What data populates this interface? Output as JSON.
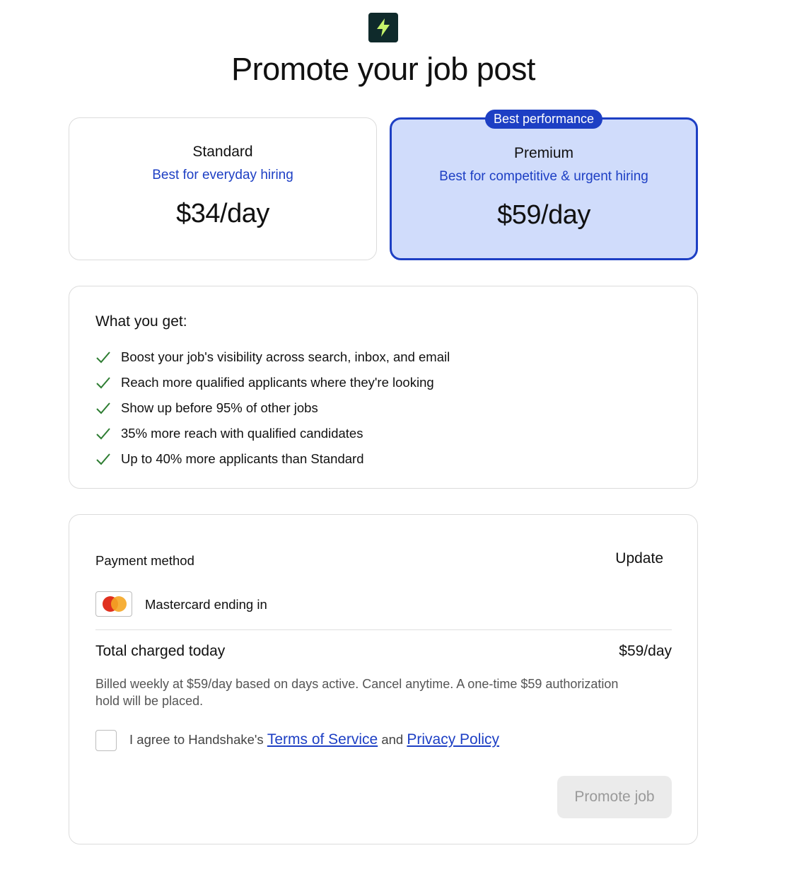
{
  "header": {
    "logo_icon": "lightning-bolt-icon",
    "title": "Promote your job post"
  },
  "plans": [
    {
      "name": "Standard",
      "tagline": "Best for everyday hiring",
      "price": "$34/day",
      "selected": false
    },
    {
      "name": "Premium",
      "tagline": "Best for competitive & urgent hiring",
      "price": "$59/day",
      "selected": true,
      "badge": "Best performance"
    }
  ],
  "benefits": {
    "heading": "What you get:",
    "items": [
      "Boost your job's visibility across search, inbox, and email",
      "Reach more qualified applicants where they're looking",
      "Show up before 95% of other jobs",
      "35% more reach with qualified candidates",
      "Up to 40% more applicants than Standard"
    ]
  },
  "payment": {
    "label": "Payment method",
    "update_label": "Update",
    "card_icon": "mastercard-icon",
    "card_text": "Mastercard ending in",
    "total_label": "Total charged today",
    "total_value": "$59/day",
    "billing_note": "Billed weekly at $59/day based on days active. Cancel anytime. A one-time $59 authorization hold will be placed.",
    "agree_prefix": "I agree to Handshake's",
    "terms_link": "Terms of Service",
    "agree_and": "and",
    "privacy_link": "Privacy Policy",
    "agree_checked": false,
    "promote_button": "Promote job",
    "promote_enabled": false
  },
  "colors": {
    "accent": "#1d3fc4",
    "premium_bg": "#d0dcfb",
    "logo_bg": "#0f2a2b",
    "bolt": "#c6f36b",
    "check": "#2e7d32"
  }
}
